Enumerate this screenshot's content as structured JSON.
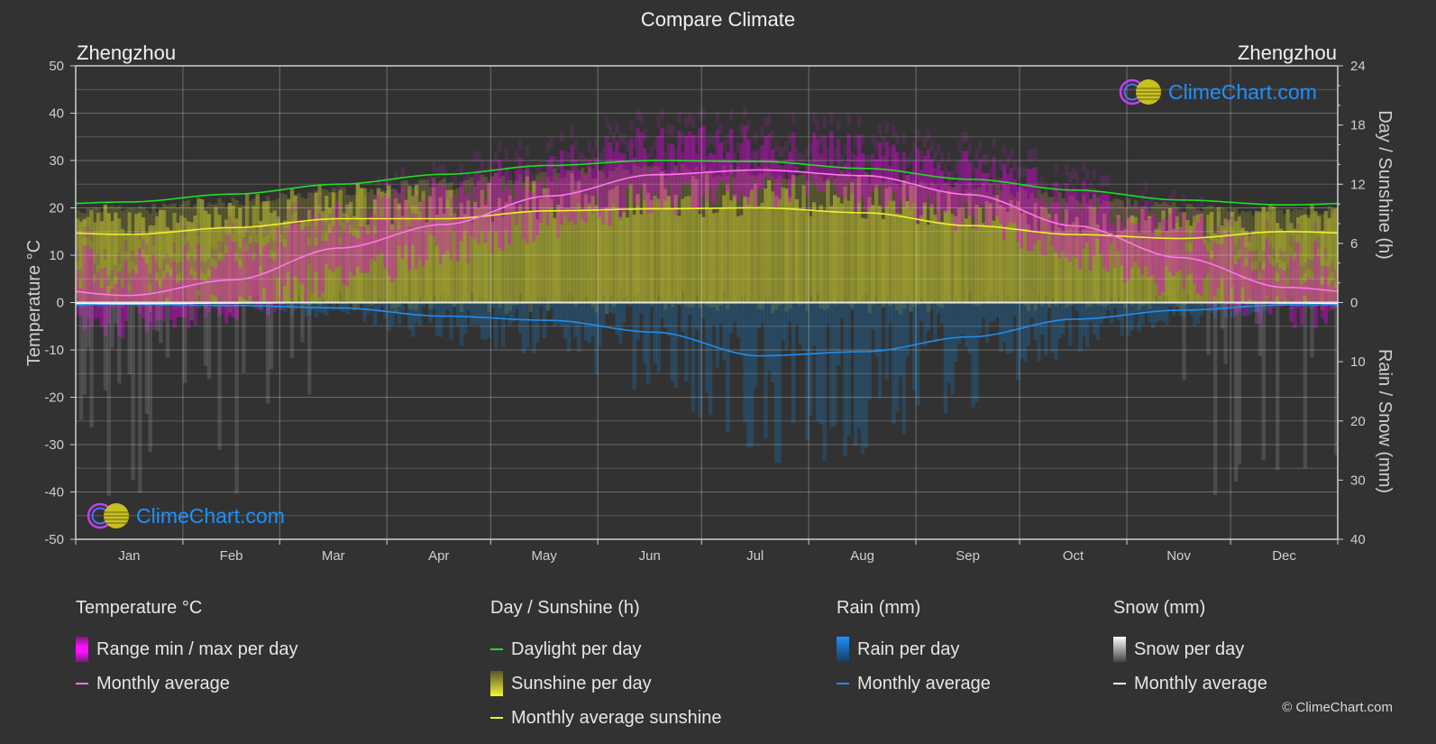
{
  "title": "Compare Climate",
  "location_left": "Zhengzhou",
  "location_right": "Zhengzhou",
  "logo_text": "ClimeChart.com",
  "copyright": "© ClimeChart.com",
  "colors": {
    "background": "#323232",
    "temp_range": "#e000e0",
    "temp_avg": "#ff77ee",
    "daylight": "#22dd22",
    "sunshine_bar": "#a8a830",
    "sunshine_avg": "#f0f030",
    "rain_bar": "#1e6ea8",
    "rain_avg": "#1e8ef0",
    "snow_bar": "#9a9a9a",
    "snow_avg": "#ffffff",
    "logo": "#1e90ff"
  },
  "chart_data": {
    "type": "line",
    "title": "Compare Climate",
    "categories": [
      "Jan",
      "Feb",
      "Mar",
      "Apr",
      "May",
      "Jun",
      "Jul",
      "Aug",
      "Sep",
      "Oct",
      "Nov",
      "Dec"
    ],
    "left_axis": {
      "label": "Temperature °C",
      "range": [
        -50,
        50
      ],
      "ticks": [
        "50",
        "40",
        "30",
        "20",
        "10",
        "0",
        "-10",
        "-20",
        "-30",
        "-40",
        "-50"
      ]
    },
    "right_axis_top": {
      "label": "Day / Sunshine (h)",
      "range": [
        0,
        24
      ],
      "ticks": [
        "24",
        "18",
        "12",
        "6",
        "0"
      ]
    },
    "right_axis_bottom": {
      "label": "Rain / Snow (mm)",
      "range": [
        0,
        40
      ],
      "ticks": [
        "10",
        "20",
        "30",
        "40"
      ]
    },
    "grid": true,
    "series": [
      {
        "name": "Temperature monthly average",
        "unit": "°C",
        "axis": "left",
        "values": [
          1.5,
          4.8,
          11.5,
          16.5,
          22.5,
          27.0,
          28.0,
          26.8,
          22.8,
          16.2,
          9.5,
          3.2
        ]
      },
      {
        "name": "Temperature daily max (approx)",
        "unit": "°C",
        "axis": "left",
        "values": [
          6.5,
          10.0,
          17.0,
          22.5,
          28.0,
          32.5,
          32.5,
          31.0,
          27.5,
          22.0,
          15.0,
          8.5
        ]
      },
      {
        "name": "Temperature daily min (approx)",
        "unit": "°C",
        "axis": "left",
        "values": [
          -3.5,
          -0.5,
          5.5,
          11.0,
          17.0,
          21.5,
          24.0,
          23.0,
          18.0,
          11.0,
          4.0,
          -2.0
        ]
      },
      {
        "name": "Daylight per day",
        "unit": "h",
        "axis": "right_top",
        "values": [
          10.2,
          11.0,
          12.0,
          13.0,
          13.9,
          14.4,
          14.3,
          13.6,
          12.5,
          11.4,
          10.4,
          9.9
        ]
      },
      {
        "name": "Monthly average sunshine",
        "unit": "h",
        "axis": "right_top",
        "values": [
          6.9,
          7.6,
          8.5,
          8.5,
          9.3,
          9.5,
          9.6,
          9.1,
          7.8,
          6.9,
          6.5,
          7.2
        ]
      },
      {
        "name": "Rain monthly average",
        "unit": "mm",
        "axis": "right_bottom",
        "values": [
          0.3,
          0.5,
          0.9,
          2.3,
          3.0,
          5.0,
          9.0,
          8.3,
          5.8,
          2.8,
          1.3,
          0.4
        ]
      },
      {
        "name": "Snow monthly average",
        "unit": "mm",
        "axis": "right_bottom",
        "values": [
          0.2,
          0.1,
          0.0,
          0.0,
          0.0,
          0.0,
          0.0,
          0.0,
          0.0,
          0.0,
          0.0,
          0.1
        ]
      }
    ]
  },
  "legend": {
    "temperature": {
      "title": "Temperature °C",
      "items": [
        "Range min / max per day",
        "Monthly average"
      ]
    },
    "sunshine": {
      "title": "Day / Sunshine (h)",
      "items": [
        "Daylight per day",
        "Sunshine per day",
        "Monthly average sunshine"
      ]
    },
    "rain": {
      "title": "Rain (mm)",
      "items": [
        "Rain per day",
        "Monthly average"
      ]
    },
    "snow": {
      "title": "Snow (mm)",
      "items": [
        "Snow per day",
        "Monthly average"
      ]
    }
  }
}
